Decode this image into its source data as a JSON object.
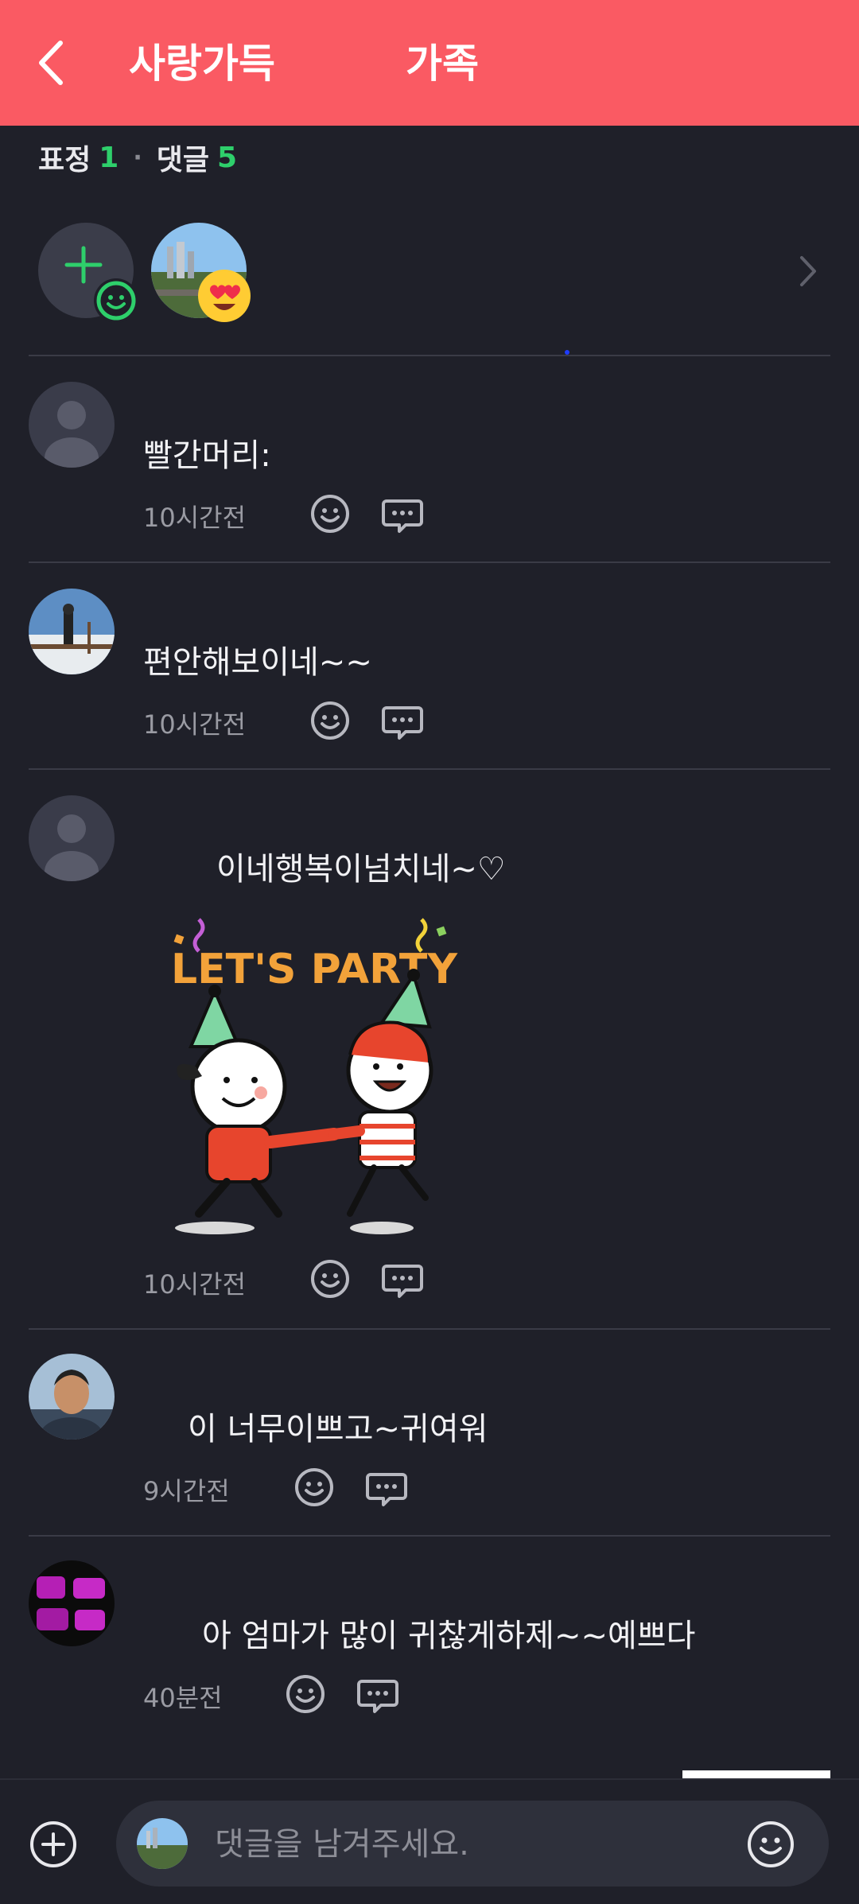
{
  "header": {
    "title": "사랑가득",
    "subtitle": "가족",
    "background_color": "#fa5a63",
    "back_icon": "chevron-left-icon"
  },
  "counts": {
    "reaction_label": "표정",
    "reaction_count": "1",
    "comment_label": "댓글",
    "comment_count": "5",
    "accent_color": "#2ecf6b"
  },
  "reactions": {
    "add_icon": "add-reaction-icon",
    "reactor_emoji": "heart-eyes-icon"
  },
  "comments": [
    {
      "name": "",
      "text": "빨간머리:",
      "time": "10시간전"
    },
    {
      "name": "",
      "text": "편안해보이네~~",
      "time": "10시간전"
    },
    {
      "name": "",
      "text": "이네행복이넘치네~♡",
      "time": "10시간전",
      "sticker_text": "LET'S PARTY"
    },
    {
      "name": "",
      "text": "이 너무이쁘고~귀여워",
      "time": "9시간전"
    },
    {
      "name": "",
      "text": "아 엄마가 많이 귀찮게하제~~예쁘다",
      "time": "40분전"
    }
  ],
  "composer": {
    "placeholder": "댓글을 남겨주세요.",
    "emoji_icon": "smile-icon",
    "add_icon": "plus-circle-icon"
  }
}
